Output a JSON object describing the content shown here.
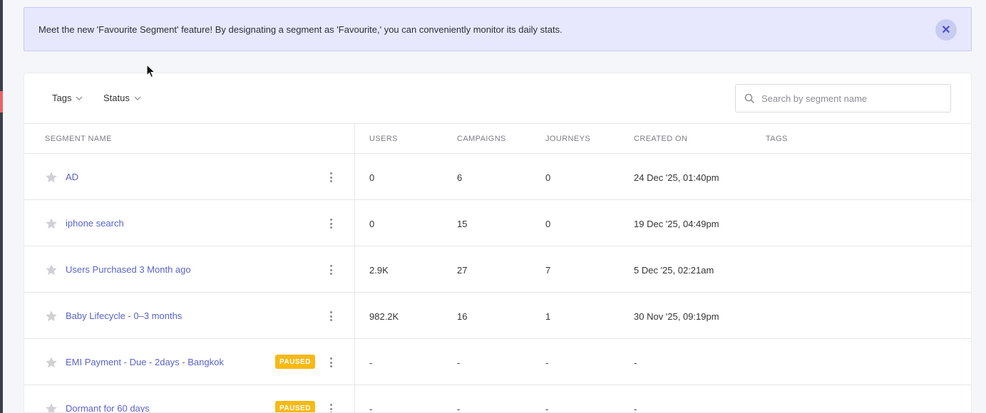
{
  "banner": {
    "text": "Meet the new 'Favourite Segment' feature! By designating a segment as 'Favourite,' you can conveniently monitor its daily stats.",
    "close_icon": "close-icon"
  },
  "filters": {
    "tags_label": "Tags",
    "status_label": "Status",
    "search_placeholder": "Search by segment name"
  },
  "table": {
    "headers": {
      "segment_name": "SEGMENT NAME",
      "users": "USERS",
      "campaigns": "CAMPAIGNS",
      "journeys": "JOURNEYS",
      "created_on": "CREATED ON",
      "tags": "TAGS"
    },
    "rows": [
      {
        "name": "AD",
        "badge": "",
        "users": "0",
        "campaigns": "6",
        "journeys": "0",
        "created_on": "24 Dec '25, 01:40pm"
      },
      {
        "name": "iphone search",
        "badge": "",
        "users": "0",
        "campaigns": "15",
        "journeys": "0",
        "created_on": "19 Dec '25, 04:49pm"
      },
      {
        "name": "Users Purchased 3 Month ago",
        "badge": "",
        "users": "2.9K",
        "campaigns": "27",
        "journeys": "7",
        "created_on": "5 Dec '25, 02:21am"
      },
      {
        "name": "Baby Lifecycle - 0–3 months",
        "badge": "",
        "users": "982.2K",
        "campaigns": "16",
        "journeys": "1",
        "created_on": "30 Nov '25, 09:19pm"
      },
      {
        "name": "EMI Payment - Due - 2days - Bangkok",
        "badge": "PAUSED",
        "users": "-",
        "campaigns": "-",
        "journeys": "-",
        "created_on": "-"
      },
      {
        "name": "Dormant for 60 days",
        "badge": "PAUSED",
        "users": "-",
        "campaigns": "-",
        "journeys": "-",
        "created_on": "-"
      }
    ]
  },
  "colors": {
    "accent": "#5a62c8",
    "banner_bg": "#e7e8fd",
    "paused_badge": "#f6b915",
    "star": "#d0d0d6"
  }
}
